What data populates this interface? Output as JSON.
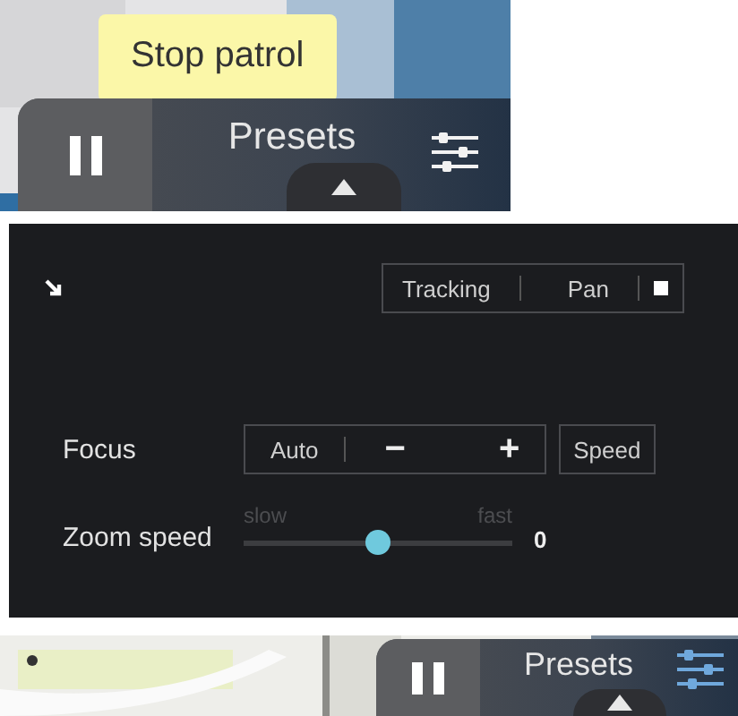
{
  "top_view": {
    "tooltip": "Stop patrol",
    "toolbar": {
      "presets_label": "Presets",
      "settings_highlighted": false
    }
  },
  "panel": {
    "mode_buttons": [
      {
        "label": "Tracking"
      },
      {
        "label": "Pan"
      }
    ],
    "focus": {
      "label": "Focus",
      "auto": "Auto",
      "minus": "−",
      "plus": "+",
      "speed": "Speed"
    },
    "zoom_speed": {
      "label": "Zoom speed",
      "min_label": "slow",
      "max_label": "fast",
      "level": 0.5,
      "reading": "0"
    }
  },
  "bottom_view": {
    "toolbar": {
      "presets_label": "Presets",
      "settings_highlighted": true
    }
  }
}
